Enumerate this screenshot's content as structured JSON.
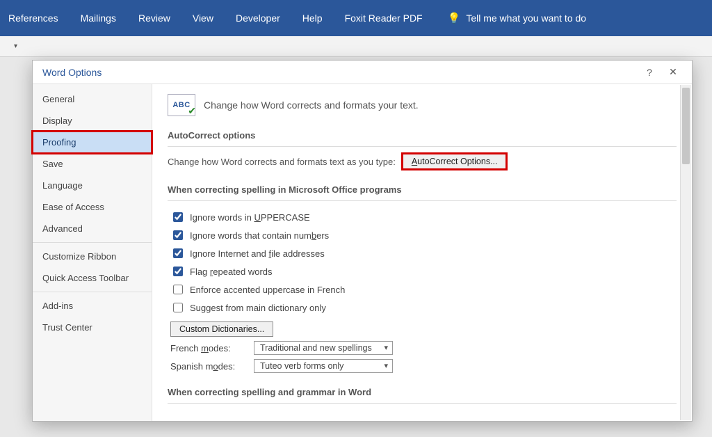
{
  "ribbon": {
    "tabs": [
      "References",
      "Mailings",
      "Review",
      "View",
      "Developer",
      "Help",
      "Foxit Reader PDF"
    ],
    "tellme": "Tell me what you want to do"
  },
  "dialog": {
    "title": "Word Options",
    "help": "?",
    "close": "✕"
  },
  "sidebar": {
    "items": [
      {
        "label": "General"
      },
      {
        "label": "Display"
      },
      {
        "label": "Proofing",
        "selected": true,
        "highlight": true
      },
      {
        "label": "Save"
      },
      {
        "label": "Language"
      },
      {
        "label": "Ease of Access"
      },
      {
        "label": "Advanced"
      },
      {
        "sep": true
      },
      {
        "label": "Customize Ribbon"
      },
      {
        "label": "Quick Access Toolbar"
      },
      {
        "sep": true
      },
      {
        "label": "Add-ins"
      },
      {
        "label": "Trust Center"
      }
    ]
  },
  "content": {
    "icon_abc": "ABC",
    "header_text": "Change how Word corrects and formats your text.",
    "section_autocorrect": "AutoCorrect options",
    "autocorrect_desc": "Change how Word corrects and formats text as you type:",
    "autocorrect_btn_prefix": "A",
    "autocorrect_btn_rest": "utoCorrect Options...",
    "section_spelling_office": "When correcting spelling in Microsoft Office programs",
    "checks": [
      {
        "checked": true,
        "pre": "Ignore words in ",
        "u": "U",
        "post": "PPERCASE"
      },
      {
        "checked": true,
        "pre": "Ignore words that contain num",
        "u": "b",
        "post": "ers"
      },
      {
        "checked": true,
        "pre": "Ignore Internet and ",
        "u": "f",
        "post": "ile addresses"
      },
      {
        "checked": true,
        "pre": "Flag ",
        "u": "r",
        "post": "epeated words"
      },
      {
        "checked": false,
        "pre": "Enforce accented uppercase in French",
        "u": "",
        "post": ""
      },
      {
        "checked": false,
        "pre": "Suggest from main dictionary only",
        "u": "",
        "post": ""
      }
    ],
    "custom_dict_btn": "Custom Dictionaries...",
    "french_label_pre": "French ",
    "french_label_u": "m",
    "french_label_post": "odes:",
    "french_value": "Traditional and new spellings",
    "spanish_label_pre": "Spanish m",
    "spanish_label_u": "o",
    "spanish_label_post": "des:",
    "spanish_value": "Tuteo verb forms only",
    "section_spelling_word": "When correcting spelling and grammar in Word"
  }
}
